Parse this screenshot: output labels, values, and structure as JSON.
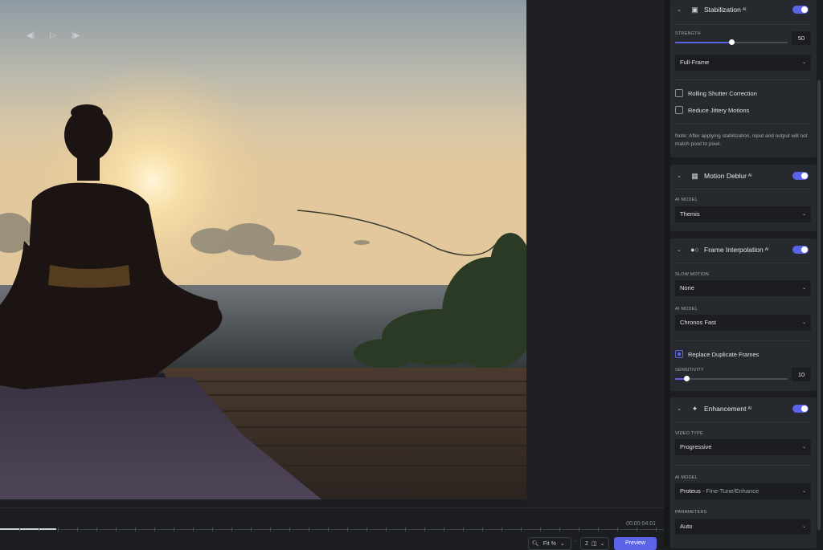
{
  "timeline": {
    "timecode": "00:00:04:01",
    "progress_fraction": 0.085
  },
  "transport": {
    "prev_icon": "step-back-icon",
    "play_icon": "play-icon",
    "next_icon": "step-forward-icon"
  },
  "toolbar": {
    "zoom_label": "Fit %",
    "separator": "-",
    "view_label": "2",
    "preview_label": "Preview"
  },
  "stabilization": {
    "title": "Stabilization",
    "ai_badge": "AI",
    "enabled": true,
    "strength_label": "STRENGTH",
    "strength_value": "50",
    "strength_fraction": 0.5,
    "mode": "Full-Frame",
    "rolling_shutter_label": "Rolling Shutter Correction",
    "rolling_shutter_checked": false,
    "reduce_jitter_label": "Reduce Jittery Motions",
    "reduce_jitter_checked": false,
    "note": "Note: After applying stabilization, input and output will not match pixel to pixel."
  },
  "motion_deblur": {
    "title": "Motion Deblur",
    "ai_badge": "AI",
    "enabled": true,
    "model_label": "AI MODEL",
    "model": "Themis"
  },
  "frame_interpolation": {
    "title": "Frame Interpolation",
    "ai_badge": "AI",
    "enabled": true,
    "slow_motion_label": "SLOW MOTION",
    "slow_motion": "None",
    "model_label": "AI MODEL",
    "model": "Chronos Fast",
    "replace_duplicates_label": "Replace Duplicate Frames",
    "replace_duplicates_checked": true,
    "sensitivity_label": "SENSITIVITY",
    "sensitivity_value": "10",
    "sensitivity_fraction": 0.1
  },
  "enhancement": {
    "title": "Enhancement",
    "ai_badge": "AI",
    "enabled": true,
    "video_type_label": "VIDEO TYPE",
    "video_type": "Progressive",
    "model_label": "AI MODEL",
    "model_name": "Proteus",
    "model_suffix": " - Fine-Tune/Enhance",
    "parameters_label": "PARAMETERS",
    "parameters": "Auto"
  }
}
